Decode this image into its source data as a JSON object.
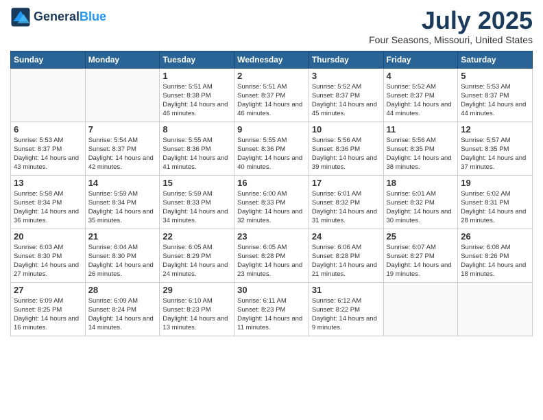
{
  "header": {
    "logo_line1": "General",
    "logo_line2": "Blue",
    "month_title": "July 2025",
    "location": "Four Seasons, Missouri, United States"
  },
  "weekdays": [
    "Sunday",
    "Monday",
    "Tuesday",
    "Wednesday",
    "Thursday",
    "Friday",
    "Saturday"
  ],
  "weeks": [
    [
      {
        "day": "",
        "info": ""
      },
      {
        "day": "",
        "info": ""
      },
      {
        "day": "1",
        "info": "Sunrise: 5:51 AM\nSunset: 8:38 PM\nDaylight: 14 hours and 46 minutes."
      },
      {
        "day": "2",
        "info": "Sunrise: 5:51 AM\nSunset: 8:37 PM\nDaylight: 14 hours and 46 minutes."
      },
      {
        "day": "3",
        "info": "Sunrise: 5:52 AM\nSunset: 8:37 PM\nDaylight: 14 hours and 45 minutes."
      },
      {
        "day": "4",
        "info": "Sunrise: 5:52 AM\nSunset: 8:37 PM\nDaylight: 14 hours and 44 minutes."
      },
      {
        "day": "5",
        "info": "Sunrise: 5:53 AM\nSunset: 8:37 PM\nDaylight: 14 hours and 44 minutes."
      }
    ],
    [
      {
        "day": "6",
        "info": "Sunrise: 5:53 AM\nSunset: 8:37 PM\nDaylight: 14 hours and 43 minutes."
      },
      {
        "day": "7",
        "info": "Sunrise: 5:54 AM\nSunset: 8:37 PM\nDaylight: 14 hours and 42 minutes."
      },
      {
        "day": "8",
        "info": "Sunrise: 5:55 AM\nSunset: 8:36 PM\nDaylight: 14 hours and 41 minutes."
      },
      {
        "day": "9",
        "info": "Sunrise: 5:55 AM\nSunset: 8:36 PM\nDaylight: 14 hours and 40 minutes."
      },
      {
        "day": "10",
        "info": "Sunrise: 5:56 AM\nSunset: 8:36 PM\nDaylight: 14 hours and 39 minutes."
      },
      {
        "day": "11",
        "info": "Sunrise: 5:56 AM\nSunset: 8:35 PM\nDaylight: 14 hours and 38 minutes."
      },
      {
        "day": "12",
        "info": "Sunrise: 5:57 AM\nSunset: 8:35 PM\nDaylight: 14 hours and 37 minutes."
      }
    ],
    [
      {
        "day": "13",
        "info": "Sunrise: 5:58 AM\nSunset: 8:34 PM\nDaylight: 14 hours and 36 minutes."
      },
      {
        "day": "14",
        "info": "Sunrise: 5:59 AM\nSunset: 8:34 PM\nDaylight: 14 hours and 35 minutes."
      },
      {
        "day": "15",
        "info": "Sunrise: 5:59 AM\nSunset: 8:33 PM\nDaylight: 14 hours and 34 minutes."
      },
      {
        "day": "16",
        "info": "Sunrise: 6:00 AM\nSunset: 8:33 PM\nDaylight: 14 hours and 32 minutes."
      },
      {
        "day": "17",
        "info": "Sunrise: 6:01 AM\nSunset: 8:32 PM\nDaylight: 14 hours and 31 minutes."
      },
      {
        "day": "18",
        "info": "Sunrise: 6:01 AM\nSunset: 8:32 PM\nDaylight: 14 hours and 30 minutes."
      },
      {
        "day": "19",
        "info": "Sunrise: 6:02 AM\nSunset: 8:31 PM\nDaylight: 14 hours and 28 minutes."
      }
    ],
    [
      {
        "day": "20",
        "info": "Sunrise: 6:03 AM\nSunset: 8:30 PM\nDaylight: 14 hours and 27 minutes."
      },
      {
        "day": "21",
        "info": "Sunrise: 6:04 AM\nSunset: 8:30 PM\nDaylight: 14 hours and 26 minutes."
      },
      {
        "day": "22",
        "info": "Sunrise: 6:05 AM\nSunset: 8:29 PM\nDaylight: 14 hours and 24 minutes."
      },
      {
        "day": "23",
        "info": "Sunrise: 6:05 AM\nSunset: 8:28 PM\nDaylight: 14 hours and 23 minutes."
      },
      {
        "day": "24",
        "info": "Sunrise: 6:06 AM\nSunset: 8:28 PM\nDaylight: 14 hours and 21 minutes."
      },
      {
        "day": "25",
        "info": "Sunrise: 6:07 AM\nSunset: 8:27 PM\nDaylight: 14 hours and 19 minutes."
      },
      {
        "day": "26",
        "info": "Sunrise: 6:08 AM\nSunset: 8:26 PM\nDaylight: 14 hours and 18 minutes."
      }
    ],
    [
      {
        "day": "27",
        "info": "Sunrise: 6:09 AM\nSunset: 8:25 PM\nDaylight: 14 hours and 16 minutes."
      },
      {
        "day": "28",
        "info": "Sunrise: 6:09 AM\nSunset: 8:24 PM\nDaylight: 14 hours and 14 minutes."
      },
      {
        "day": "29",
        "info": "Sunrise: 6:10 AM\nSunset: 8:23 PM\nDaylight: 14 hours and 13 minutes."
      },
      {
        "day": "30",
        "info": "Sunrise: 6:11 AM\nSunset: 8:23 PM\nDaylight: 14 hours and 11 minutes."
      },
      {
        "day": "31",
        "info": "Sunrise: 6:12 AM\nSunset: 8:22 PM\nDaylight: 14 hours and 9 minutes."
      },
      {
        "day": "",
        "info": ""
      },
      {
        "day": "",
        "info": ""
      }
    ]
  ]
}
